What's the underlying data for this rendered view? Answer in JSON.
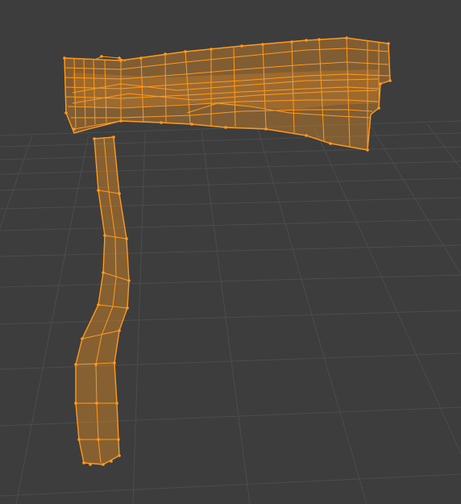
{
  "viewport": {
    "mode": "Edit Mode",
    "display": "wireframe",
    "colors": {
      "background": "#3d3d3d",
      "grid_line": "#4a4a4a",
      "selected_edge": "#ff9a1f",
      "selected_vertex": "#ff9a1f",
      "face_fill": "#ff9a1f"
    },
    "selection": {
      "object": "axe-mesh",
      "all_selected": true
    }
  }
}
